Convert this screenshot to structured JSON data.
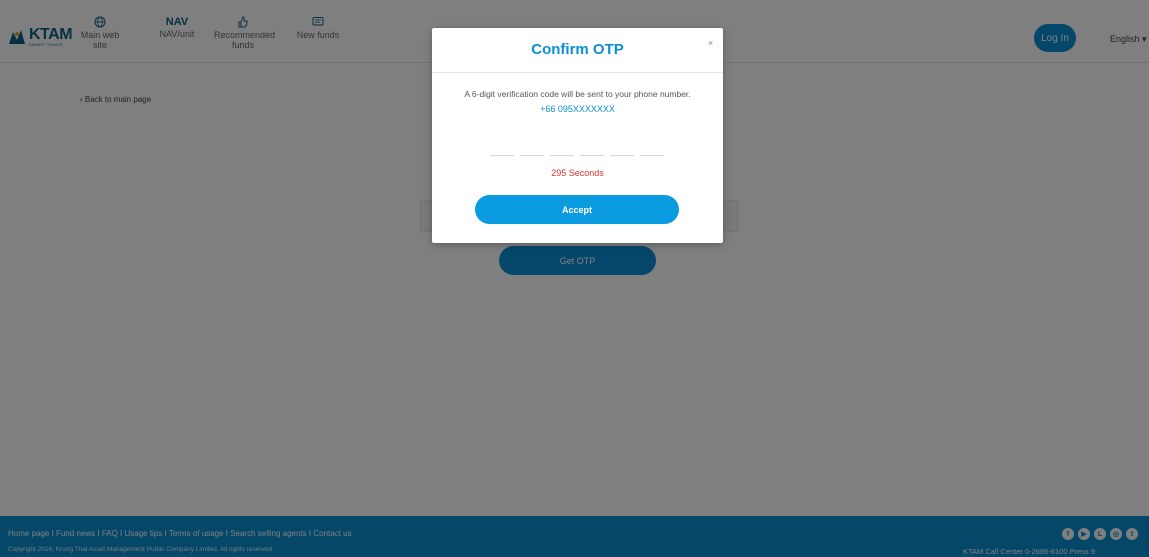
{
  "header": {
    "logo": {
      "name": "KTAM",
      "sub": "SMART TRADE"
    },
    "nav": [
      {
        "label": "Main web site",
        "icon": "globe-icon"
      },
      {
        "label": "NAV",
        "sub": "NAV/unit",
        "icon": "nav-text"
      },
      {
        "label": "Recommended",
        "sub": "funds",
        "icon": "thumbs-up-icon"
      },
      {
        "label": "New funds",
        "icon": "chat-icon"
      }
    ],
    "login_label": "Log In",
    "language": "English ▾"
  },
  "main": {
    "back_link": "Back to main page",
    "get_otp_label": "Get OTP"
  },
  "modal": {
    "title": "Confirm OTP",
    "close": "×",
    "message": "A 6-digit verification code will be sent to your phone number.",
    "phone": "+66 095XXXXXXX",
    "otp_slots": 6,
    "countdown": "295 Seconds",
    "accept_label": "Accept"
  },
  "footer": {
    "links": "Home page I Fund news I FAQ I Usage tips I Terms of usage I Search selling agents I Contact us",
    "copyright": "Copyright 2016, Krung Thai Asset Management Public Company Limited. All rights reserved.",
    "callcenter": "KTAM Call Center 0-2686-6100 Press 9",
    "socials": [
      "facebook-icon",
      "youtube-icon",
      "line-icon",
      "instagram-icon",
      "twitter-icon"
    ]
  },
  "colors": {
    "brand": "#0a8fd6",
    "brand_dark": "#0a5f86",
    "countdown": "#e0312f"
  }
}
